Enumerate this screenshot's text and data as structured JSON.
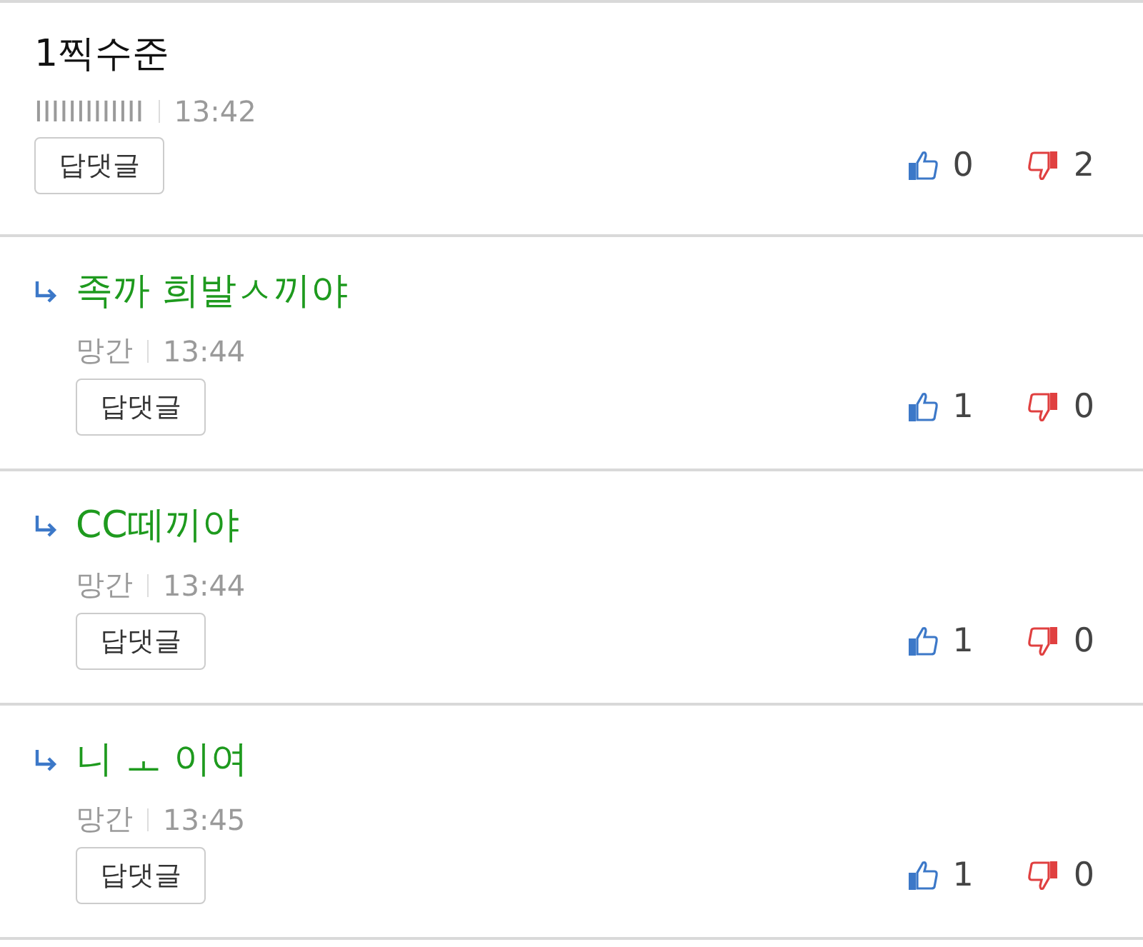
{
  "comments": [
    {
      "kind": "comment",
      "text": "1찍수준",
      "author": "IIIIIIIIIIIII",
      "time": "13:42",
      "reply_button": "답댓글",
      "likes": "0",
      "dislikes": "2"
    },
    {
      "kind": "reply",
      "text": "족까 희발ㅅ끼야",
      "author": "망간",
      "time": "13:44",
      "reply_button": "답댓글",
      "likes": "1",
      "dislikes": "0"
    },
    {
      "kind": "reply",
      "text": "CC떼끼야",
      "author": "망간",
      "time": "13:44",
      "reply_button": "답댓글",
      "likes": "1",
      "dislikes": "0"
    },
    {
      "kind": "reply",
      "text": "니 ㅗ 이여",
      "author": "망간",
      "time": "13:45",
      "reply_button": "답댓글",
      "likes": "1",
      "dislikes": "0"
    }
  ]
}
